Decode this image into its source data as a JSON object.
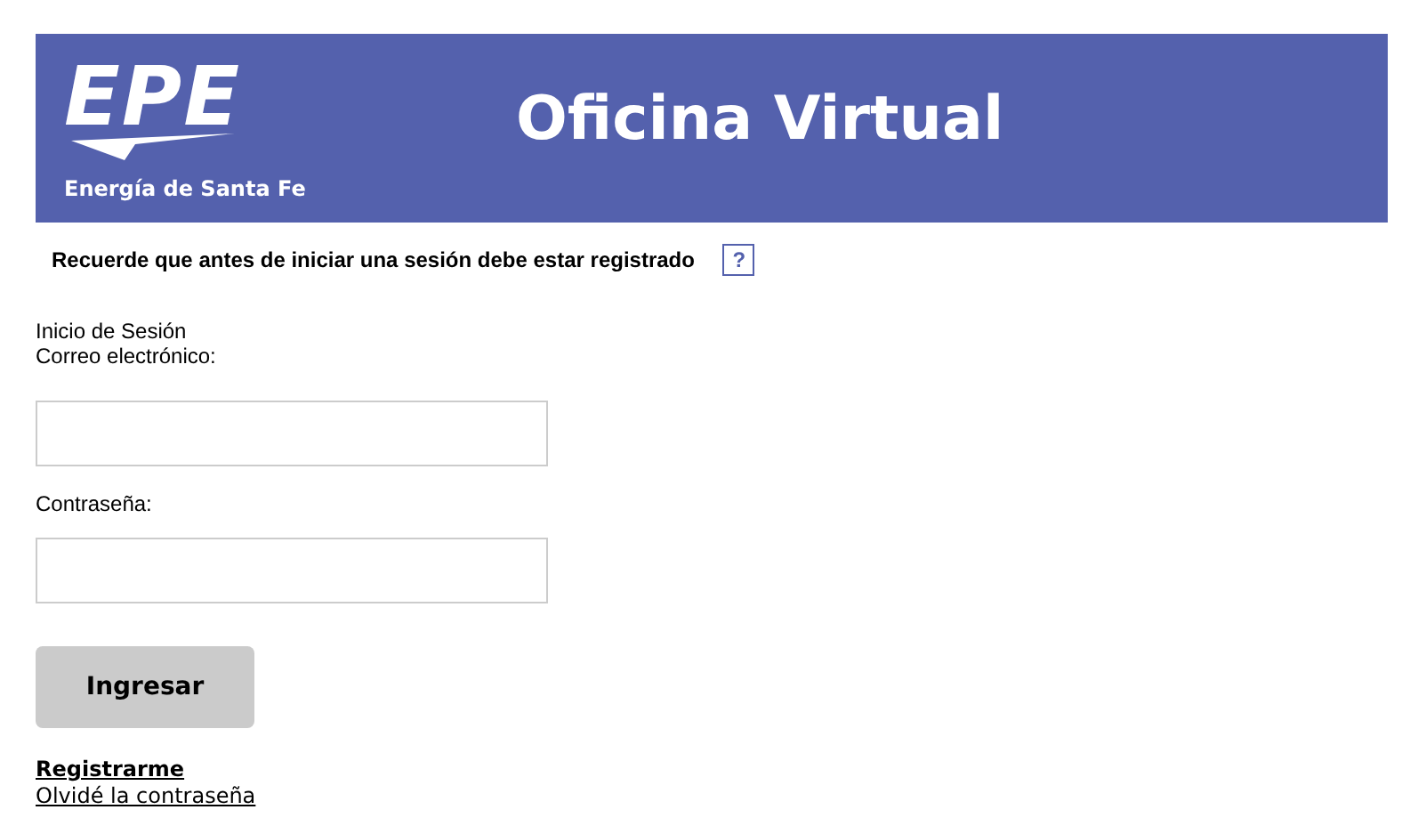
{
  "header": {
    "logo_text": "EPE",
    "logo_subtitle": "Energía de Santa Fe",
    "title": "Oficina Virtual"
  },
  "notice": {
    "text": "Recuerde que antes de iniciar una sesión debe estar registrado",
    "help": "?"
  },
  "form": {
    "heading": "Inicio de Sesión",
    "fields": [
      {
        "label": "Correo electrónico:"
      },
      {
        "label": "Contraseña:"
      }
    ],
    "submit": "Ingresar"
  },
  "links": [
    {
      "text": "Registrarme",
      "bold": true
    },
    {
      "text": "Olvidé la contraseña",
      "bold": false
    }
  ]
}
